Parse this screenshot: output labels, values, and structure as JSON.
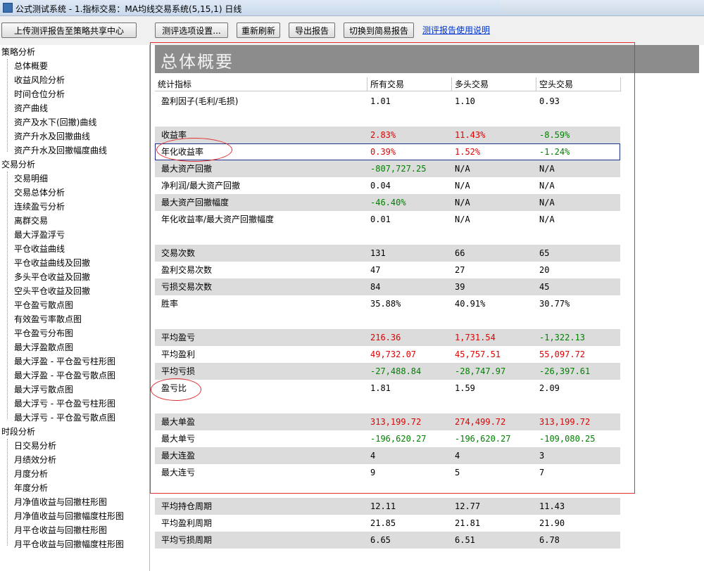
{
  "window": {
    "title": "公式测试系统 - 1.指标交易：MA均线交易系统(5,15,1) 日线"
  },
  "toolbar": {
    "upload": "上传测评报告至策略共享中心",
    "settings": "测评选项设置...",
    "refresh": "重新刷新",
    "export": "导出报告",
    "switch": "切换到简易报告",
    "help_link": "测评报告使用说明"
  },
  "sidebar": {
    "cat_strategy": "策略分析",
    "strategy": [
      "总体概要",
      "收益风险分析",
      "时间仓位分析",
      "资产曲线",
      "资产及水下(回撤)曲线",
      "资产升水及回撤曲线",
      "资产升水及回撤幅度曲线"
    ],
    "cat_trade": "交易分析",
    "trade": [
      "交易明细",
      "交易总体分析",
      "连续盈亏分析",
      "离群交易",
      "最大浮盈浮亏",
      "平仓收益曲线",
      "平仓收益曲线及回撤",
      "多头平仓收益及回撤",
      "空头平仓收益及回撤",
      "平仓盈亏散点图",
      "有效盈亏率散点图",
      "平仓盈亏分布图",
      "最大浮盈散点图",
      "最大浮盈 - 平仓盈亏柱形图",
      "最大浮盈 - 平仓盈亏散点图",
      "最大浮亏散点图",
      "最大浮亏 - 平仓盈亏柱形图",
      "最大浮亏 - 平仓盈亏散点图"
    ],
    "cat_period": "时段分析",
    "period": [
      "日交易分析",
      "月绩效分析",
      "月度分析",
      "年度分析",
      "月净值收益与回撤柱形图",
      "月净值收益与回撤幅度柱形图",
      "月平仓收益与回撤柱形图",
      "月平仓收益与回撤幅度柱形图"
    ]
  },
  "report": {
    "title": "总体概要",
    "columns": [
      "统计指标",
      "所有交易",
      "多头交易",
      "空头交易"
    ],
    "rows": [
      {
        "label": "盈利因子(毛利/毛损)",
        "all": "1.01",
        "long": "1.10",
        "short": "0.93"
      },
      {
        "label": "收益率",
        "all": "2.83%",
        "long": "11.43%",
        "short": "-8.59%"
      },
      {
        "label": "年化收益率",
        "all": "0.39%",
        "long": "1.52%",
        "short": "-1.24%"
      },
      {
        "label": "最大资产回撤",
        "all": "-807,727.25",
        "long": "N/A",
        "short": "N/A"
      },
      {
        "label": "净利润/最大资产回撤",
        "all": "0.04",
        "long": "N/A",
        "short": "N/A"
      },
      {
        "label": "最大资产回撤幅度",
        "all": "-46.40%",
        "long": "N/A",
        "short": "N/A"
      },
      {
        "label": "年化收益率/最大资产回撤幅度",
        "all": "0.01",
        "long": "N/A",
        "short": "N/A"
      },
      {
        "label": "交易次数",
        "all": "131",
        "long": "66",
        "short": "65"
      },
      {
        "label": "盈利交易次数",
        "all": "47",
        "long": "27",
        "short": "20"
      },
      {
        "label": "亏损交易次数",
        "all": "84",
        "long": "39",
        "short": "45"
      },
      {
        "label": "胜率",
        "all": "35.88%",
        "long": "40.91%",
        "short": "30.77%"
      },
      {
        "label": "平均盈亏",
        "all": "216.36",
        "long": "1,731.54",
        "short": "-1,322.13"
      },
      {
        "label": "平均盈利",
        "all": "49,732.07",
        "long": "45,757.51",
        "short": "55,097.72"
      },
      {
        "label": "平均亏损",
        "all": "-27,488.84",
        "long": "-28,747.97",
        "short": "-26,397.61"
      },
      {
        "label": "盈亏比",
        "all": "1.81",
        "long": "1.59",
        "short": "2.09"
      },
      {
        "label": "最大单盈",
        "all": "313,199.72",
        "long": "274,499.72",
        "short": "313,199.72"
      },
      {
        "label": "最大单亏",
        "all": "-196,620.27",
        "long": "-196,620.27",
        "short": "-109,080.25"
      },
      {
        "label": "最大连盈",
        "all": "4",
        "long": "4",
        "short": "3"
      },
      {
        "label": "最大连亏",
        "all": "9",
        "long": "5",
        "short": "7"
      },
      {
        "label": "平均持仓周期",
        "all": "12.11",
        "long": "12.77",
        "short": "11.43"
      },
      {
        "label": "平均盈利周期",
        "all": "21.85",
        "long": "21.81",
        "short": "21.90"
      },
      {
        "label": "平均亏损周期",
        "all": "6.65",
        "long": "6.51",
        "short": "6.78"
      }
    ]
  },
  "colors": {
    "positive": "#e00000",
    "negative": "#008000",
    "header_bg": "#8c8c8c",
    "annotation": "#e03030"
  }
}
